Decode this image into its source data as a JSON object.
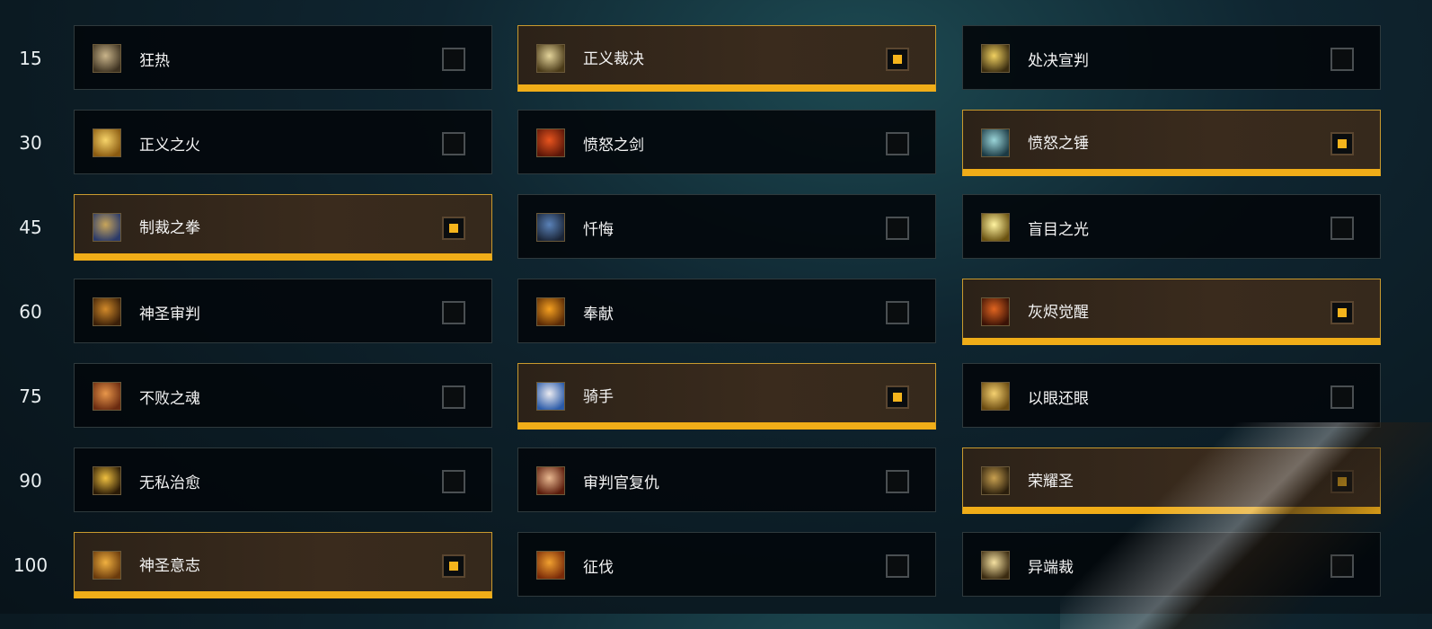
{
  "colors": {
    "accent": "#f0ad18",
    "selected_bg": "#3a2b1d",
    "card_bg": "#03080c",
    "text": "#f4f4f4"
  },
  "rows": [
    {
      "level": "15",
      "talents": [
        {
          "name": "狂热",
          "icon": "zeal-icon",
          "selected": false,
          "colors": [
            "#c9b48a",
            "#3d3221"
          ]
        },
        {
          "name": "正义裁决",
          "icon": "righteous-verdict-icon",
          "selected": true,
          "colors": [
            "#e3d39a",
            "#4a3a18"
          ]
        },
        {
          "name": "处决宣判",
          "icon": "execution-sentence-icon",
          "selected": false,
          "colors": [
            "#f0d060",
            "#3b2d10"
          ]
        }
      ]
    },
    {
      "level": "30",
      "talents": [
        {
          "name": "正义之火",
          "icon": "fires-of-justice-icon",
          "selected": false,
          "colors": [
            "#f7d46a",
            "#8a5a10"
          ]
        },
        {
          "name": "愤怒之剑",
          "icon": "blade-of-wrath-icon",
          "selected": false,
          "colors": [
            "#e8541e",
            "#5a1608"
          ]
        },
        {
          "name": "愤怒之锤",
          "icon": "hammer-of-wrath-icon",
          "selected": true,
          "colors": [
            "#9ad4d8",
            "#1c3a44"
          ]
        }
      ]
    },
    {
      "level": "45",
      "talents": [
        {
          "name": "制裁之拳",
          "icon": "fist-of-justice-icon",
          "selected": true,
          "colors": [
            "#c8a55a",
            "#2a3a6a"
          ]
        },
        {
          "name": "忏悔",
          "icon": "repentance-icon",
          "selected": false,
          "colors": [
            "#5a82b8",
            "#1a2436"
          ]
        },
        {
          "name": "盲目之光",
          "icon": "blinding-light-icon",
          "selected": false,
          "colors": [
            "#fff3a0",
            "#6a5210"
          ]
        }
      ]
    },
    {
      "level": "60",
      "talents": [
        {
          "name": "神圣审判",
          "icon": "divine-judgment-icon",
          "selected": false,
          "colors": [
            "#d28a2a",
            "#3a1f08"
          ]
        },
        {
          "name": "奉献",
          "icon": "consecration-icon",
          "selected": false,
          "colors": [
            "#f5a020",
            "#5a2a06"
          ]
        },
        {
          "name": "灰烬觉醒",
          "icon": "wake-of-ashes-icon",
          "selected": true,
          "colors": [
            "#e06420",
            "#3a1206"
          ]
        }
      ]
    },
    {
      "level": "75",
      "talents": [
        {
          "name": "不败之魂",
          "icon": "unbreakable-spirit-icon",
          "selected": false,
          "colors": [
            "#e8964a",
            "#6a2a10"
          ]
        },
        {
          "name": "骑手",
          "icon": "cavalier-icon",
          "selected": true,
          "colors": [
            "#eaeaf0",
            "#2a5aa8"
          ]
        },
        {
          "name": "以眼还眼",
          "icon": "eye-for-an-eye-icon",
          "selected": false,
          "colors": [
            "#f4d070",
            "#6a4a10"
          ]
        }
      ]
    },
    {
      "level": "90",
      "talents": [
        {
          "name": "无私治愈",
          "icon": "selfless-healer-icon",
          "selected": false,
          "colors": [
            "#f0c040",
            "#2a1a06"
          ]
        },
        {
          "name": "审判官复仇",
          "icon": "justicars-vengeance-icon",
          "selected": false,
          "colors": [
            "#e8b890",
            "#5a1a0a"
          ]
        },
        {
          "name": "荣耀圣",
          "icon": "word-of-glory-icon",
          "selected": true,
          "colors": [
            "#c8a050",
            "#2a1e0c"
          ]
        }
      ]
    },
    {
      "level": "100",
      "talents": [
        {
          "name": "神圣意志",
          "icon": "divine-purpose-icon",
          "selected": true,
          "colors": [
            "#f0b040",
            "#6a3a0c"
          ]
        },
        {
          "name": "征伐",
          "icon": "crusade-icon",
          "selected": false,
          "colors": [
            "#f0a030",
            "#7a2a08"
          ]
        },
        {
          "name": "异端裁",
          "icon": "inquisition-icon",
          "selected": false,
          "colors": [
            "#f4e0a0",
            "#3a2a10"
          ]
        }
      ]
    }
  ]
}
